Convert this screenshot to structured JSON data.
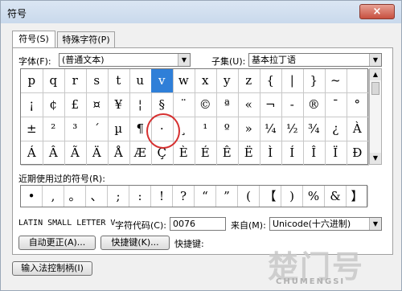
{
  "window": {
    "title": "符号",
    "close_label": "×"
  },
  "tabs": [
    {
      "label": "符号(S)"
    },
    {
      "label": "特殊字符(P)"
    }
  ],
  "font": {
    "label": "字体(F):",
    "value": "(普通文本)"
  },
  "subset": {
    "label": "子集(U):",
    "value": "基本拉丁语"
  },
  "symbol_grid": [
    [
      "p",
      "q",
      "r",
      "s",
      "t",
      "u",
      "v",
      "w",
      "x",
      "y",
      "z",
      "{",
      "|",
      "}",
      "~",
      ""
    ],
    [
      "¡",
      "¢",
      "£",
      "¤",
      "¥",
      "¦",
      "§",
      "¨",
      "©",
      "ª",
      "«",
      "¬",
      "-",
      "®",
      "¯",
      "°"
    ],
    [
      "±",
      "²",
      "³",
      "´",
      "µ",
      "¶",
      "·",
      "¸",
      "¹",
      "º",
      "»",
      "¼",
      "½",
      "¾",
      "¿",
      "À"
    ],
    [
      "Á",
      "Â",
      "Ã",
      "Ä",
      "Å",
      "Æ",
      "Ç",
      "È",
      "É",
      "Ê",
      "Ë",
      "Ì",
      "Í",
      "Î",
      "Ï",
      "Ð"
    ]
  ],
  "selected_char": "v",
  "recent": {
    "label": "近期使用过的符号(R):",
    "items": [
      "•",
      ",",
      "。",
      "、",
      ";",
      ":",
      "!",
      "?",
      "“",
      "”",
      "(",
      "【",
      ")",
      "%",
      "&",
      "】"
    ]
  },
  "char_name": "LATIN SMALL LETTER V",
  "char_code": {
    "label": "字符代码(C):",
    "value": "0076"
  },
  "from": {
    "label": "来自(M):",
    "value": "Unicode(十六进制)"
  },
  "buttons": {
    "autocorrect": "自动更正(A)...",
    "shortcut_key": "快捷键(K)...",
    "shortcut_label": "快捷键:",
    "ime": "输入法控制柄(I)"
  },
  "watermark": {
    "brand": "楚门号",
    "sub": "CHUMENGSI"
  }
}
